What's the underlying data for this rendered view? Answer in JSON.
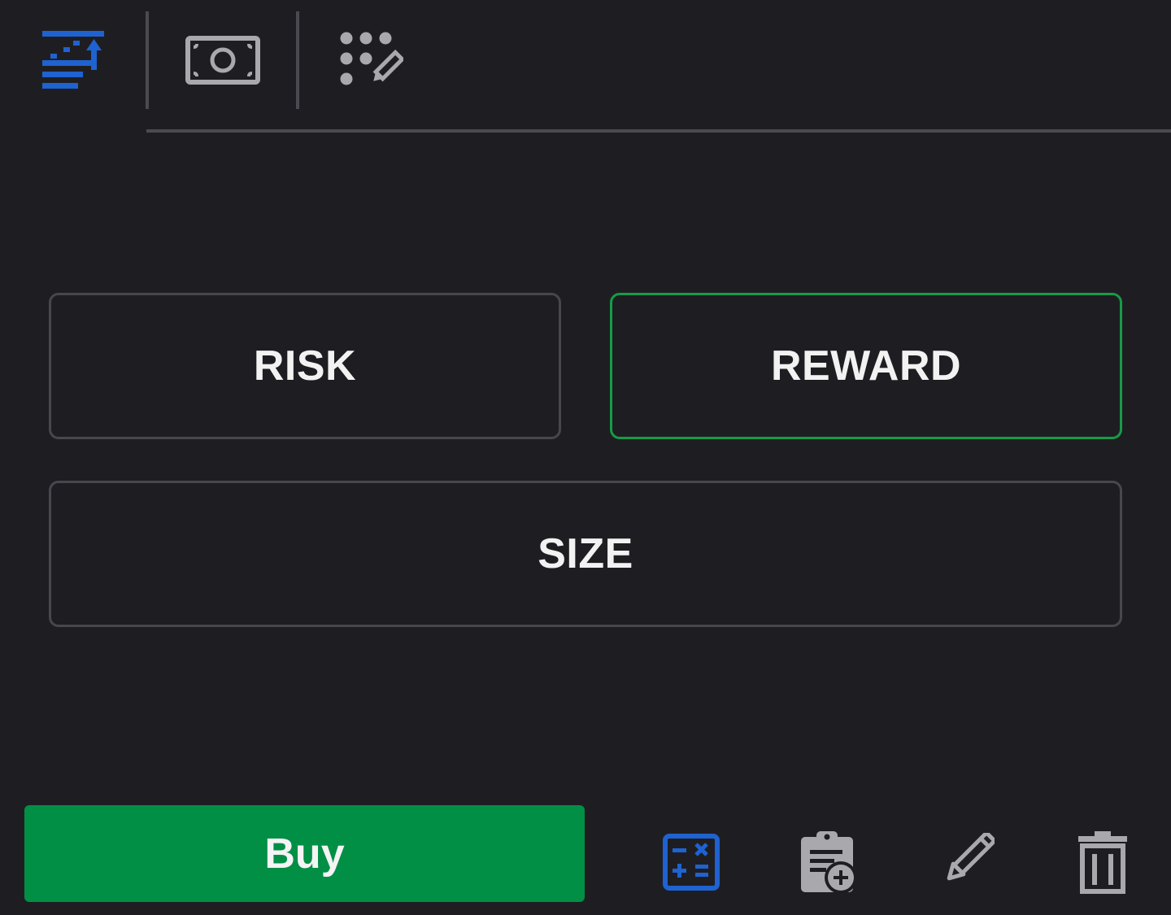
{
  "tabs": [
    {
      "icon": "sort-ascending-icon",
      "active": true
    },
    {
      "icon": "banknote-icon",
      "active": false
    },
    {
      "icon": "dot-grid-edit-icon",
      "active": false
    }
  ],
  "fields": {
    "risk_label": "RISK",
    "reward_label": "REWARD",
    "size_label": "SIZE"
  },
  "bottom_bar": {
    "buy_label": "Buy",
    "actions": [
      "calculator-icon",
      "clipboard-add-icon",
      "pencil-icon",
      "trash-icon"
    ]
  },
  "colors": {
    "background": "#1e1e22",
    "accent_blue": "#1f62d1",
    "buy_green": "#018f46",
    "active_border_green": "#179a48",
    "icon_gray": "#a9a9ad",
    "border_gray": "#47474d"
  }
}
